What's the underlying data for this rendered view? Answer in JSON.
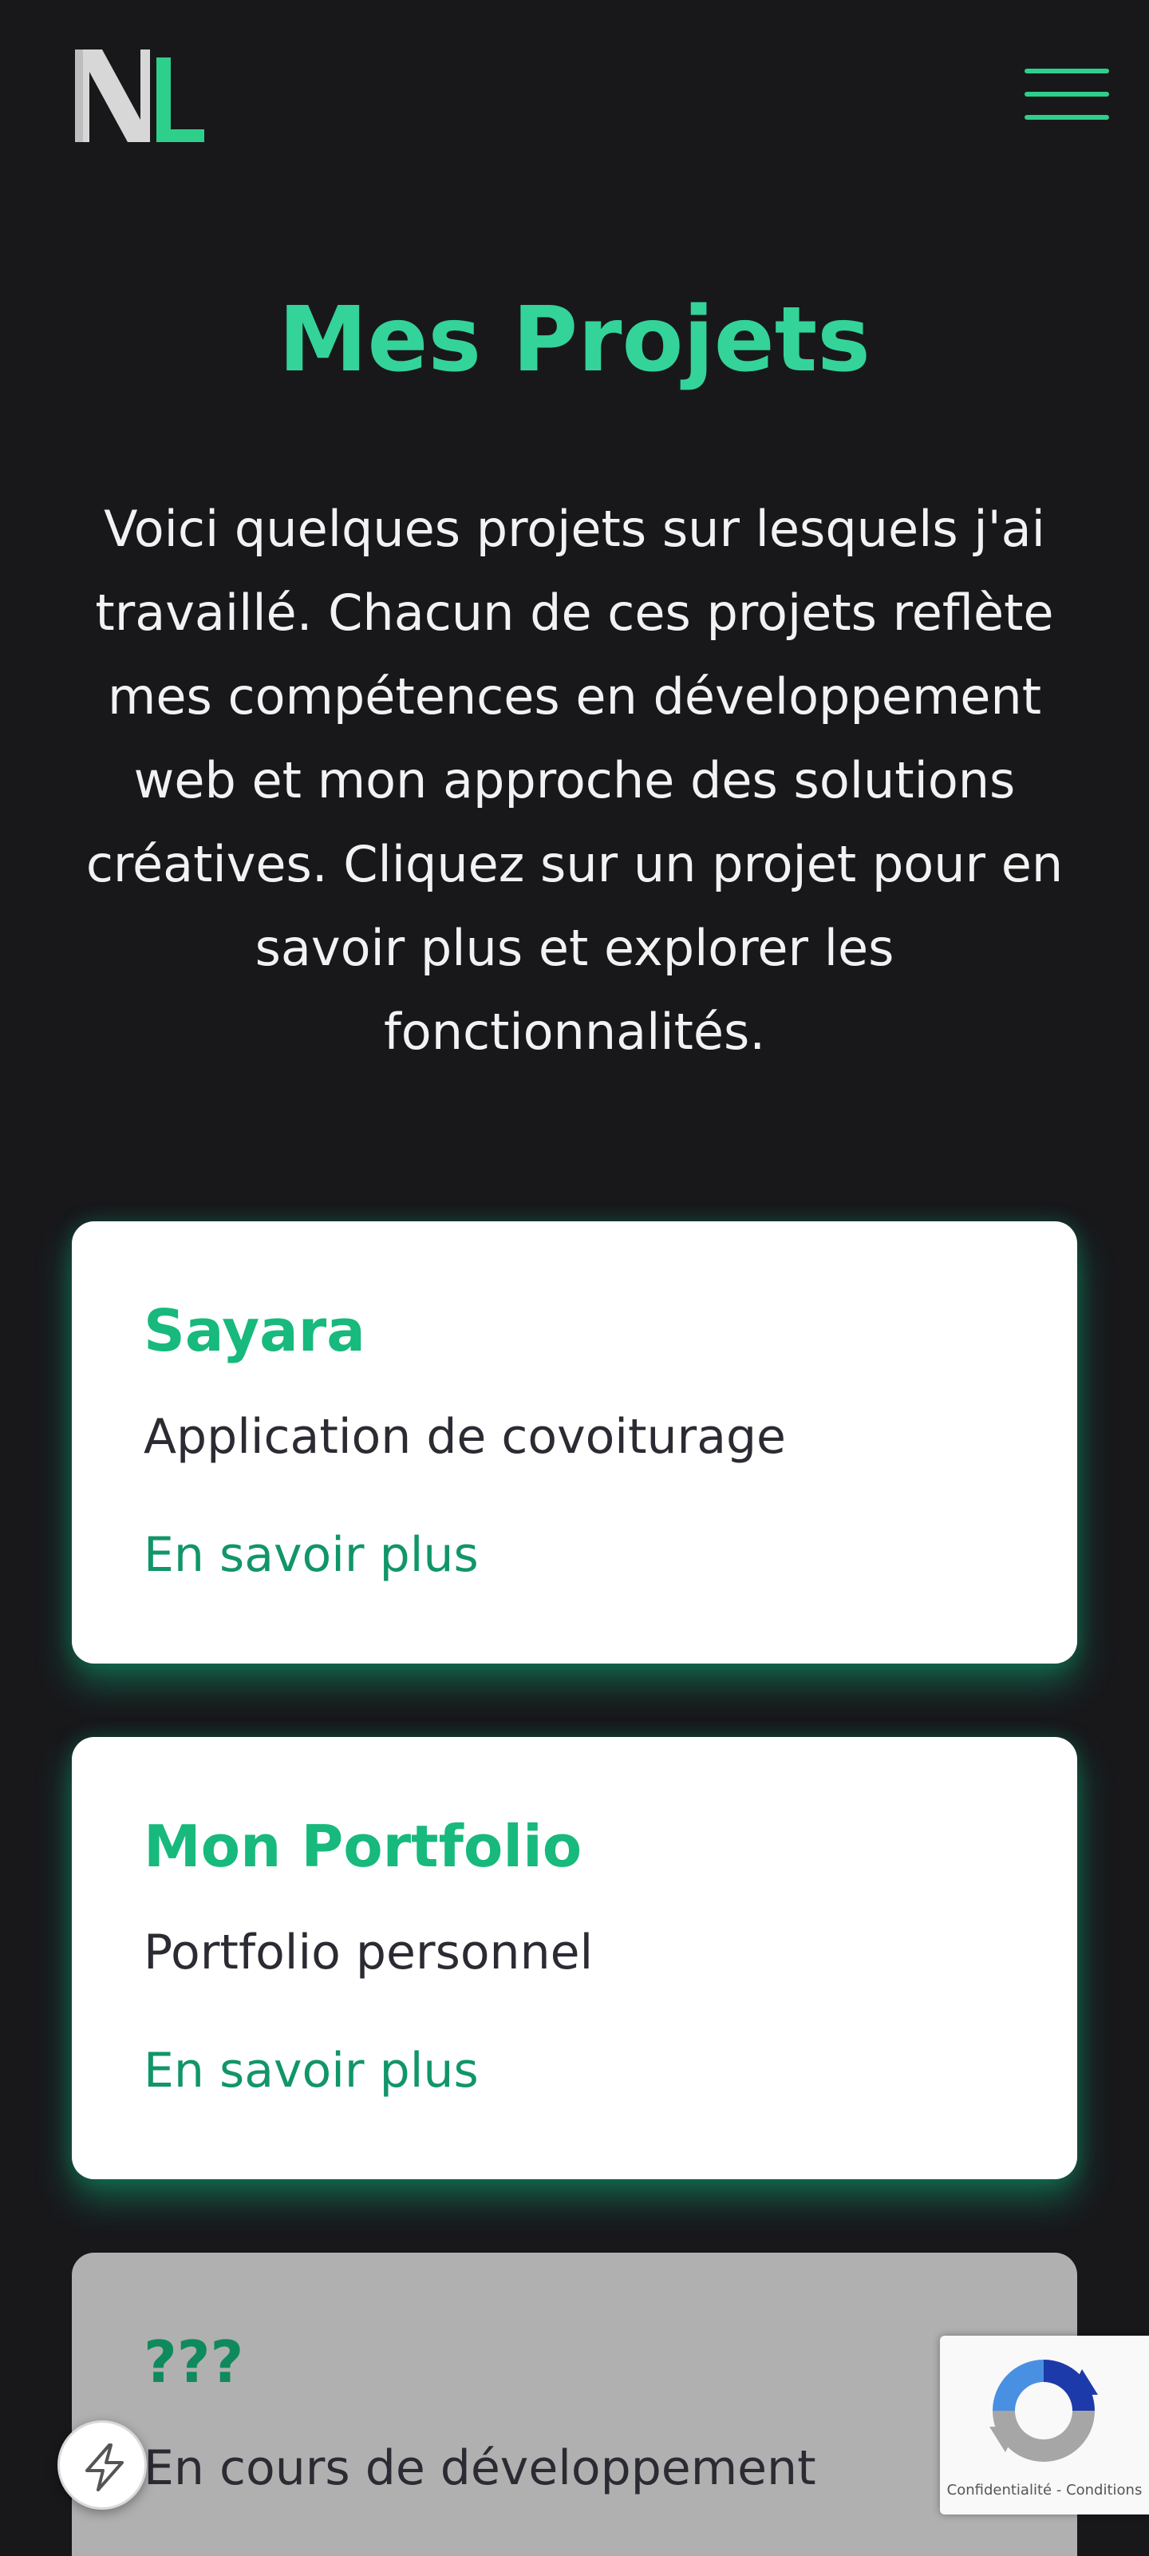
{
  "header": {
    "logo_icon": "nl-monogram-logo",
    "menu_icon": "hamburger-menu-icon"
  },
  "main": {
    "title": "Mes Projets",
    "intro": "Voici quelques projets sur lesquels j'ai travaillé. Chacun de ces projets reflète mes compétences en développement web et mon approche des solutions créatives. Cliquez sur un projet pour en savoir plus et explorer les fonctionnalités."
  },
  "projects": [
    {
      "title": "Sayara",
      "description": "Application de covoiturage",
      "link": "En savoir plus"
    },
    {
      "title": "Mon Portfolio",
      "description": "Portfolio personnel",
      "link": "En savoir plus"
    },
    {
      "title": "???",
      "description": "En cours de développement"
    }
  ],
  "widgets": {
    "lightning_icon": "lightning-icon",
    "recaptcha": {
      "icon": "recaptcha-logo-icon",
      "privacy": "Confidentialité",
      "separator": " - ",
      "terms": "Conditions"
    }
  },
  "colors": {
    "background": "#18181b",
    "accent": "#34d399",
    "card": "#ffffff",
    "card_disabled": "#b0b0b0",
    "link": "#11956a"
  }
}
